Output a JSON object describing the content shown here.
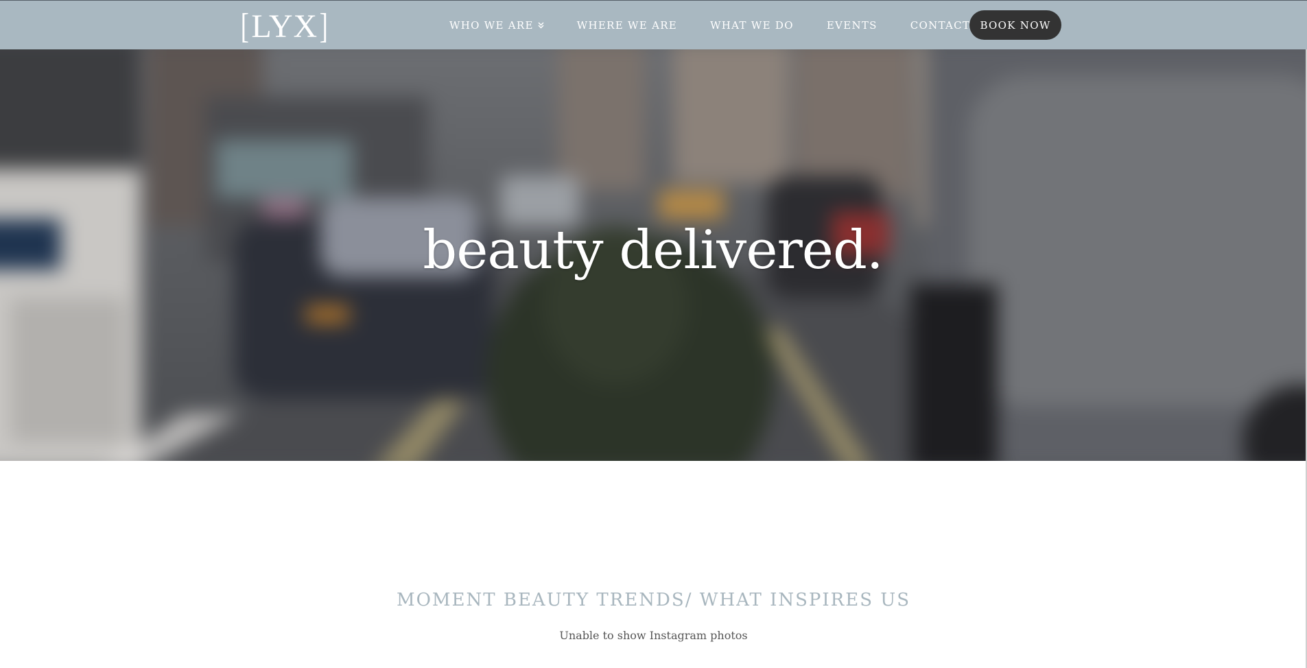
{
  "brand": {
    "logo_text": "LYX",
    "logo_left_bracket": "[",
    "logo_right_bracket": "]"
  },
  "nav": {
    "items": [
      {
        "label": "WHO WE ARE",
        "has_dropdown": true
      },
      {
        "label": "WHERE WE ARE",
        "has_dropdown": false
      },
      {
        "label": "WHAT WE DO",
        "has_dropdown": false
      },
      {
        "label": "EVENTS",
        "has_dropdown": false
      },
      {
        "label": "CONTACT",
        "has_dropdown": true
      }
    ],
    "book_label": "BOOK NOW"
  },
  "hero": {
    "title": "beauty delivered."
  },
  "instagram": {
    "title": "MOMENT BEAUTY TRENDS/ WHAT INSPIRES US",
    "message": "Unable to show Instagram photos"
  },
  "colors": {
    "header_bg": "#a9b8c1",
    "book_button_bg": "#333333",
    "section_title": "#a8b6be"
  }
}
